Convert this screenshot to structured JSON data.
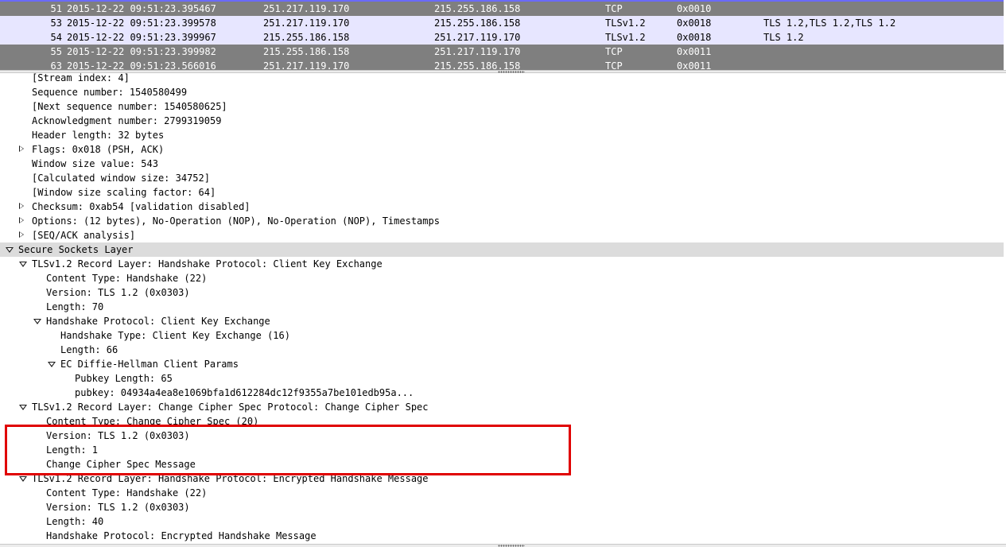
{
  "packets": [
    {
      "no": "51",
      "time": "2015-12-22 09:51:23.395467",
      "src": "251.217.119.170",
      "dst": "215.255.186.158",
      "proto": "TCP",
      "len": "0x0010",
      "info": ""
    },
    {
      "no": "53",
      "time": "2015-12-22 09:51:23.399578",
      "src": "251.217.119.170",
      "dst": "215.255.186.158",
      "proto": "TLSv1.2",
      "len": "0x0018",
      "info": "TLS 1.2,TLS 1.2,TLS 1.2"
    },
    {
      "no": "54",
      "time": "2015-12-22 09:51:23.399967",
      "src": "215.255.186.158",
      "dst": "251.217.119.170",
      "proto": "TLSv1.2",
      "len": "0x0018",
      "info": "TLS 1.2"
    },
    {
      "no": "55",
      "time": "2015-12-22 09:51:23.399982",
      "src": "215.255.186.158",
      "dst": "251.217.119.170",
      "proto": "TCP",
      "len": "0x0011",
      "info": ""
    },
    {
      "no": "63",
      "time": "2015-12-22 09:51:23.566016",
      "src": "251.217.119.170",
      "dst": "215.255.186.158",
      "proto": "TCP",
      "len": "0x0011",
      "info": ""
    }
  ],
  "details": [
    {
      "text": "[Stream index: 4]",
      "level": 2,
      "expander": "none"
    },
    {
      "text": "Sequence number: 1540580499",
      "level": 2,
      "expander": "none"
    },
    {
      "text": "[Next sequence number: 1540580625]",
      "level": 2,
      "expander": "none"
    },
    {
      "text": "Acknowledgment number: 2799319059",
      "level": 2,
      "expander": "none"
    },
    {
      "text": "Header length: 32 bytes",
      "level": 2,
      "expander": "none"
    },
    {
      "text": "Flags: 0x018 (PSH, ACK)",
      "level": 2,
      "expander": "closed"
    },
    {
      "text": "Window size value: 543",
      "level": 2,
      "expander": "none"
    },
    {
      "text": "[Calculated window size: 34752]",
      "level": 2,
      "expander": "none"
    },
    {
      "text": "[Window size scaling factor: 64]",
      "level": 2,
      "expander": "none"
    },
    {
      "text": "Checksum: 0xab54 [validation disabled]",
      "level": 2,
      "expander": "closed"
    },
    {
      "text": "Options: (12 bytes), No-Operation (NOP), No-Operation (NOP), Timestamps",
      "level": 2,
      "expander": "closed"
    },
    {
      "text": "[SEQ/ACK analysis]",
      "level": 2,
      "expander": "closed"
    },
    {
      "text": "Secure Sockets Layer",
      "level": 1,
      "expander": "open",
      "highlight": true
    },
    {
      "text": "TLSv1.2 Record Layer: Handshake Protocol: Client Key Exchange",
      "level": 2,
      "expander": "open"
    },
    {
      "text": "Content Type: Handshake (22)",
      "level": 3,
      "expander": "none"
    },
    {
      "text": "Version: TLS 1.2 (0x0303)",
      "level": 3,
      "expander": "none"
    },
    {
      "text": "Length: 70",
      "level": 3,
      "expander": "none"
    },
    {
      "text": "Handshake Protocol: Client Key Exchange",
      "level": 3,
      "expander": "open"
    },
    {
      "text": "Handshake Type: Client Key Exchange (16)",
      "level": 4,
      "expander": "none"
    },
    {
      "text": "Length: 66",
      "level": 4,
      "expander": "none"
    },
    {
      "text": "EC Diffie-Hellman Client Params",
      "level": 4,
      "expander": "open"
    },
    {
      "text": "Pubkey Length: 65",
      "level": 5,
      "expander": "none"
    },
    {
      "text": "pubkey: 04934a4ea8e1069bfa1d612284dc12f9355a7be101edb95a...",
      "level": 5,
      "expander": "none"
    },
    {
      "text": "TLSv1.2 Record Layer: Change Cipher Spec Protocol: Change Cipher Spec",
      "level": 2,
      "expander": "open"
    },
    {
      "text": "Content Type: Change Cipher Spec (20)",
      "level": 3,
      "expander": "none"
    },
    {
      "text": "Version: TLS 1.2 (0x0303)",
      "level": 3,
      "expander": "none"
    },
    {
      "text": "Length: 1",
      "level": 3,
      "expander": "none"
    },
    {
      "text": "Change Cipher Spec Message",
      "level": 3,
      "expander": "none"
    },
    {
      "text": "TLSv1.2 Record Layer: Handshake Protocol: Encrypted Handshake Message",
      "level": 2,
      "expander": "open"
    },
    {
      "text": "Content Type: Handshake (22)",
      "level": 3,
      "expander": "none"
    },
    {
      "text": "Version: TLS 1.2 (0x0303)",
      "level": 3,
      "expander": "none"
    },
    {
      "text": "Length: 40",
      "level": 3,
      "expander": "none"
    },
    {
      "text": "Handshake Protocol: Encrypted Handshake Message",
      "level": 3,
      "expander": "none"
    }
  ],
  "colors": {
    "tls_row": "#e7e6ff",
    "tcp_dark_row": "#7f7f7f",
    "highlight_row": "#dcdcdc",
    "annotation_box": "#e00000"
  }
}
